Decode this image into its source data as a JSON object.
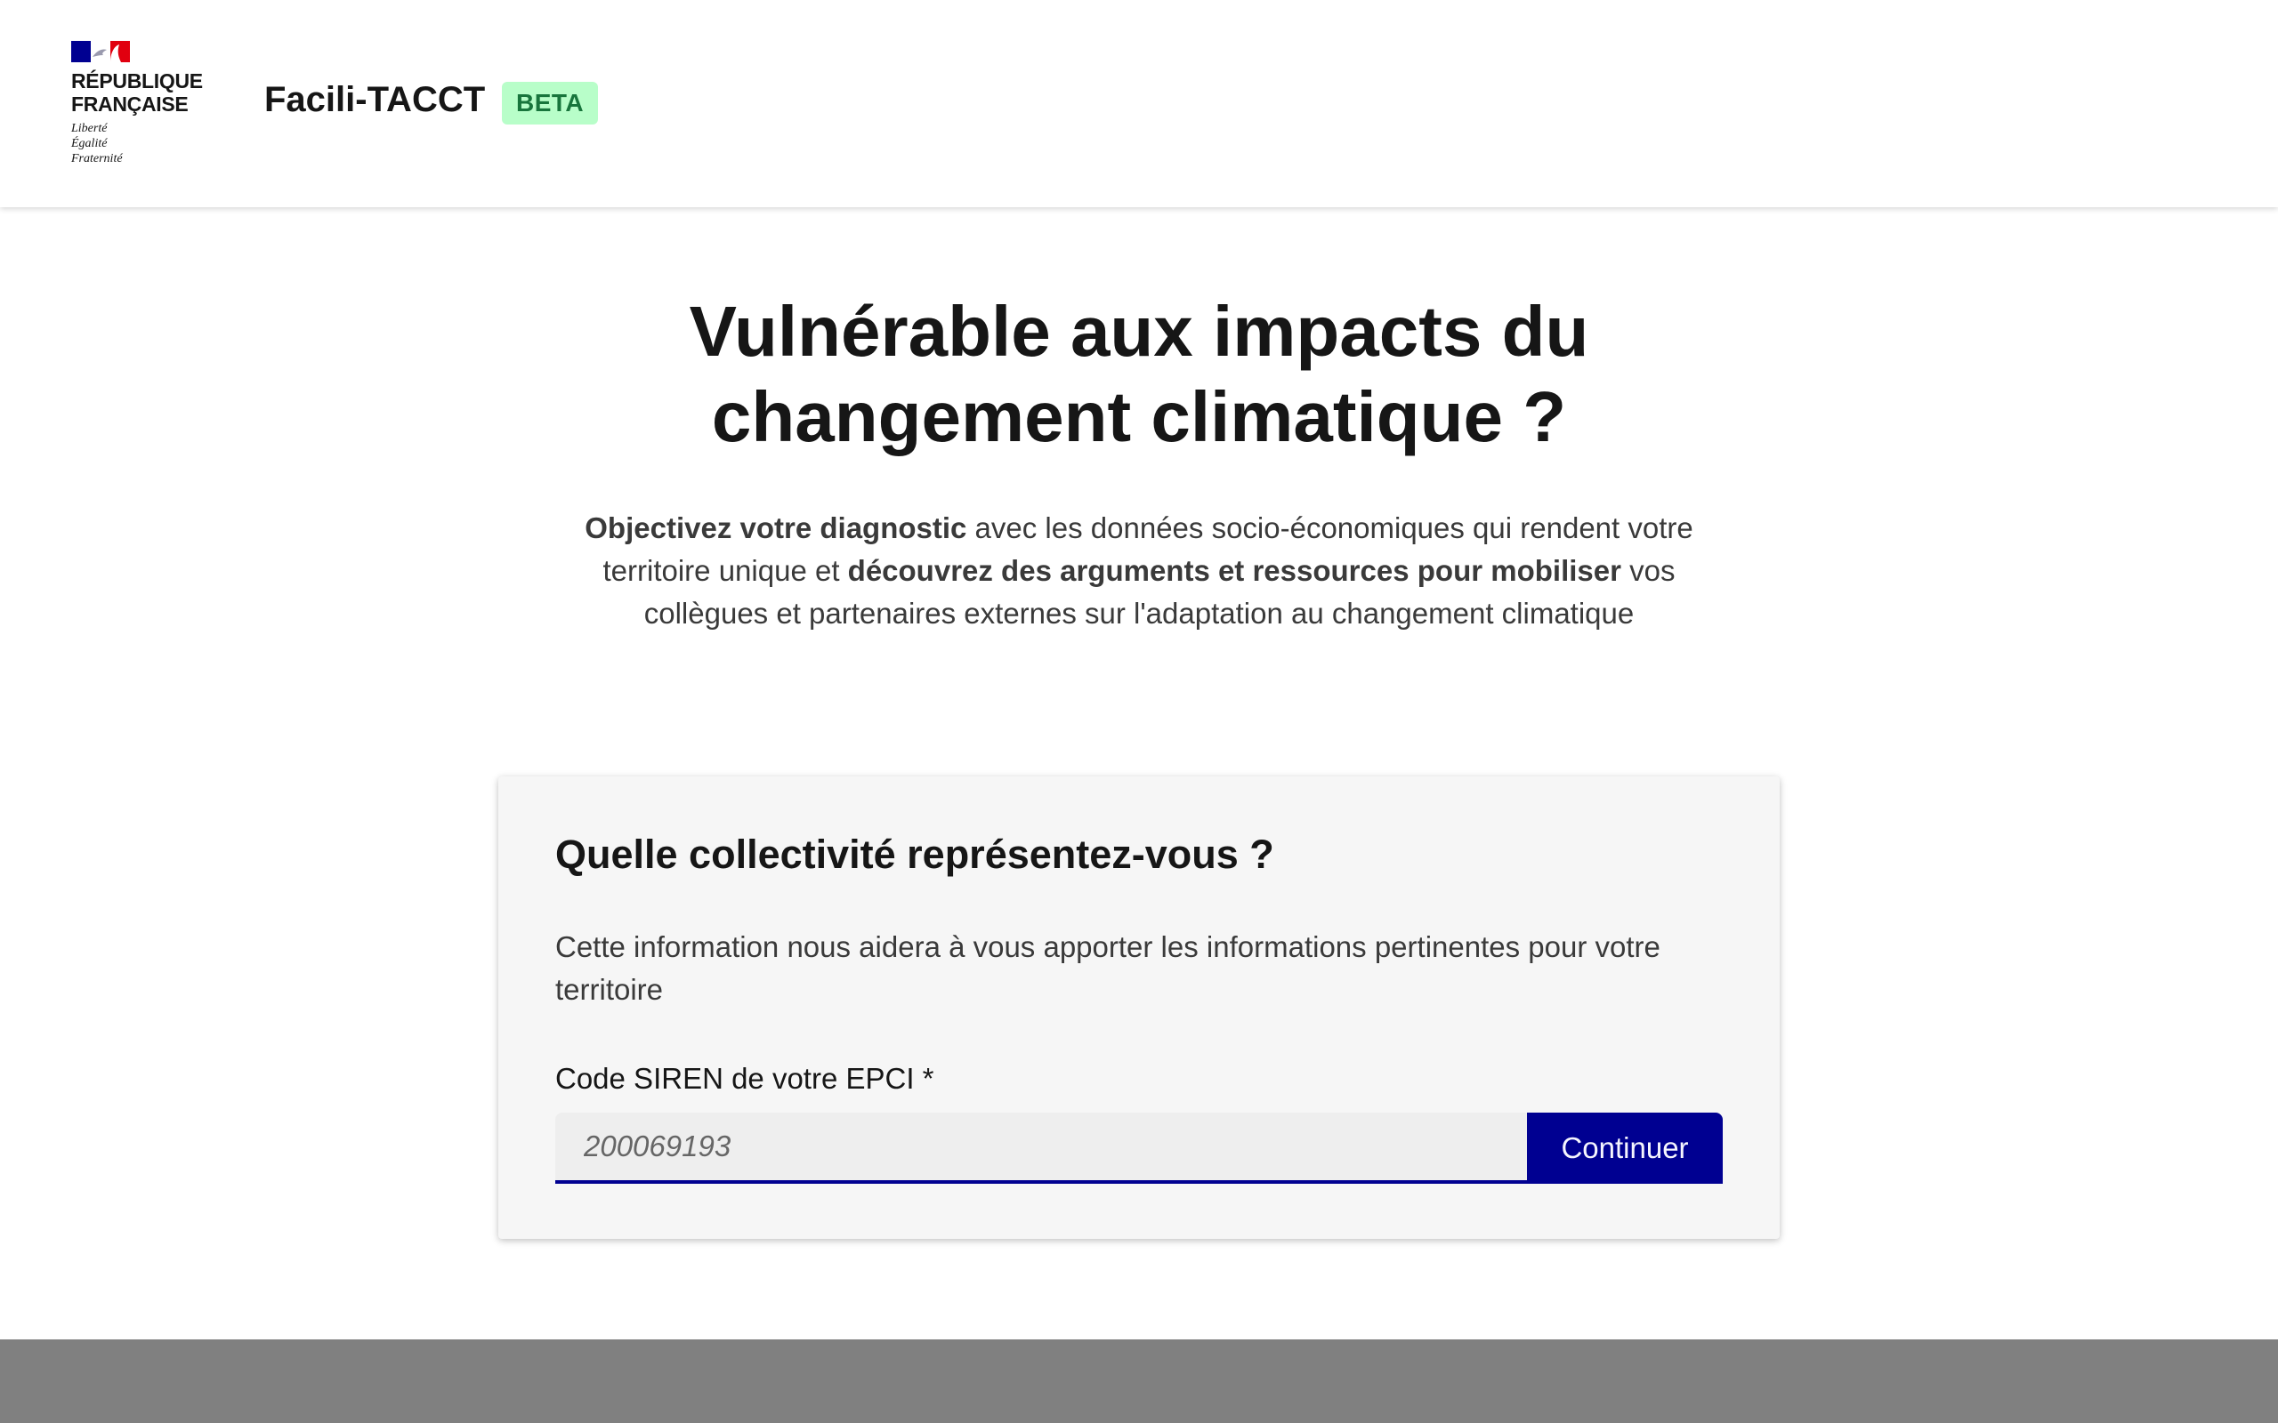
{
  "header": {
    "logo": {
      "title": "RÉPUBLIQUE\nFRANÇAISE",
      "motto": "Liberté\nÉgalité\nFraternité",
      "flag_colors": [
        "#000091",
        "#ffffff",
        "#e1000f"
      ]
    },
    "service_name": "Facili-TACCT",
    "badge": "BETA"
  },
  "hero": {
    "title": "Vulnérable aux impacts du\nchangement climatique ?",
    "lead": {
      "part1_bold": "Objectivez votre diagnostic",
      "part2": " avec les données socio-économiques qui rendent votre territoire unique et ",
      "part3_bold": "découvrez des arguments et ressources pour mobiliser",
      "part4": " vos collègues et partenaires externes sur l'adaptation au changement climatique"
    }
  },
  "form": {
    "title": "Quelle collectivité représentez-vous ?",
    "description": "Cette information nous aidera à vous apporter les informations pertinentes pour votre territoire",
    "field_label": "Code SIREN de votre EPCI *",
    "input_value": "",
    "input_placeholder": "200069193",
    "submit_label": "Continuer"
  },
  "colors": {
    "primary": "#000091",
    "badge_bg": "#b8fec9",
    "badge_text": "#18753c",
    "card_bg": "#f6f6f6",
    "footer_bg": "#808080"
  }
}
